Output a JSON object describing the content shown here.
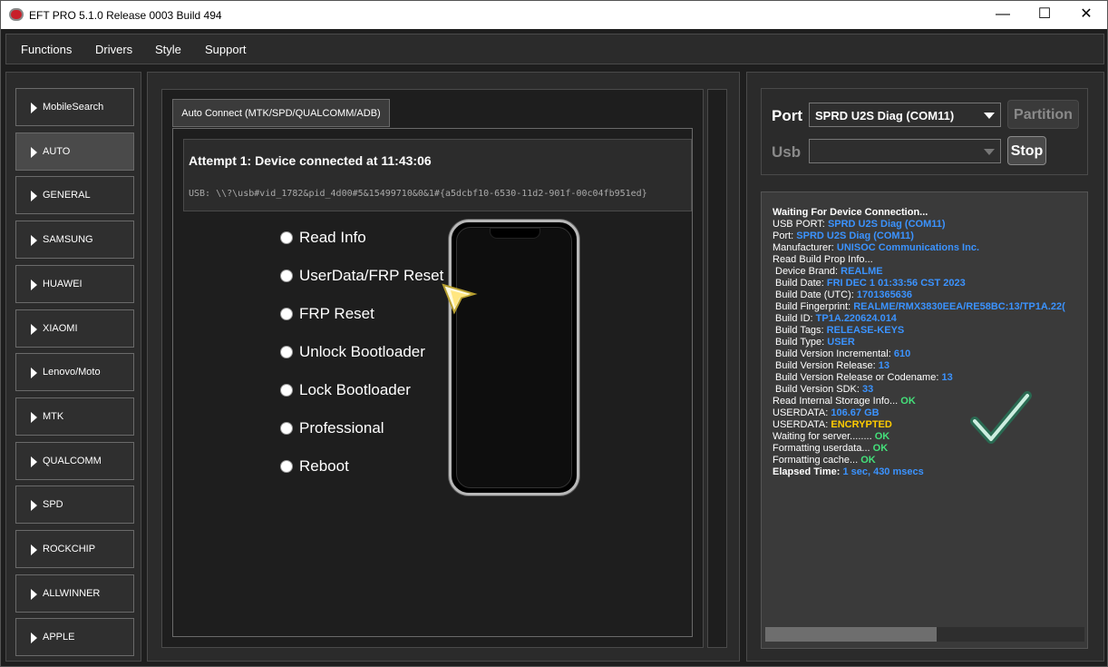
{
  "window": {
    "title": "EFT PRO 5.1.0 Release 0003 Build 494",
    "minimize": "—",
    "maximize": "☐",
    "close": "✕"
  },
  "menu": [
    "Functions",
    "Drivers",
    "Style",
    "Support"
  ],
  "sidebar": [
    {
      "label": "MobileSearch",
      "active": false
    },
    {
      "label": "AUTO",
      "active": true
    },
    {
      "label": "GENERAL",
      "active": false
    },
    {
      "label": "SAMSUNG",
      "active": false
    },
    {
      "label": "HUAWEI",
      "active": false
    },
    {
      "label": "XIAOMI",
      "active": false
    },
    {
      "label": "Lenovo/Moto",
      "active": false
    },
    {
      "label": "MTK",
      "active": false
    },
    {
      "label": "QUALCOMM",
      "active": false
    },
    {
      "label": "SPD",
      "active": false
    },
    {
      "label": "ROCKCHIP",
      "active": false
    },
    {
      "label": "ALLWINNER",
      "active": false
    },
    {
      "label": "APPLE",
      "active": false
    }
  ],
  "main": {
    "tab": "Auto Connect (MTK/SPD/QUALCOMM/ADB)",
    "status": "Attempt 1: Device connected at 11:43:06",
    "usb_path": "USB: \\\\?\\usb#vid_1782&pid_4d00#5&15499710&0&1#{a5dcbf10-6530-11d2-901f-00c04fb951ed}",
    "options": [
      "Read Info",
      "UserData/FRP Reset",
      "FRP Reset",
      "Unlock Bootloader",
      "Lock Bootloader",
      "Professional",
      "Reboot"
    ]
  },
  "port": {
    "port_label": "Port",
    "port_value": "SPRD U2S Diag (COM11)",
    "usb_label": "Usb",
    "usb_value": "",
    "partition_button": "Partition",
    "stop_button": "Stop"
  },
  "log": [
    {
      "indent": false,
      "bold": true,
      "parts": [
        {
          "t": "Waiting For Device Connection...",
          "c": ""
        }
      ]
    },
    {
      "indent": false,
      "parts": [
        {
          "t": "USB PORT: ",
          "c": ""
        },
        {
          "t": "SPRD U2S Diag (COM11)",
          "c": "v"
        }
      ]
    },
    {
      "indent": false,
      "parts": [
        {
          "t": "Port: ",
          "c": ""
        },
        {
          "t": "SPRD U2S Diag (COM11)",
          "c": "v"
        }
      ]
    },
    {
      "indent": false,
      "parts": [
        {
          "t": "Manufacturer: ",
          "c": ""
        },
        {
          "t": "UNISOC Communications Inc.",
          "c": "v"
        }
      ]
    },
    {
      "indent": false,
      "parts": [
        {
          "t": "Read Build Prop Info...",
          "c": ""
        }
      ]
    },
    {
      "indent": true,
      "parts": [
        {
          "t": "Device Brand: ",
          "c": ""
        },
        {
          "t": "REALME",
          "c": "v"
        }
      ]
    },
    {
      "indent": true,
      "parts": [
        {
          "t": "Build Date: ",
          "c": ""
        },
        {
          "t": "FRI DEC  1 01:33:56 CST 2023",
          "c": "v"
        }
      ]
    },
    {
      "indent": true,
      "parts": [
        {
          "t": "Build Date (UTC): ",
          "c": ""
        },
        {
          "t": "1701365636",
          "c": "v"
        }
      ]
    },
    {
      "indent": true,
      "parts": [
        {
          "t": "Build Fingerprint: ",
          "c": ""
        },
        {
          "t": "REALME/RMX3830EEA/RE58BC:13/TP1A.22(",
          "c": "v"
        }
      ]
    },
    {
      "indent": true,
      "parts": [
        {
          "t": "Build ID: ",
          "c": ""
        },
        {
          "t": "TP1A.220624.014",
          "c": "v"
        }
      ]
    },
    {
      "indent": true,
      "parts": [
        {
          "t": "Build Tags: ",
          "c": ""
        },
        {
          "t": "RELEASE-KEYS",
          "c": "v"
        }
      ]
    },
    {
      "indent": true,
      "parts": [
        {
          "t": "Build Type: ",
          "c": ""
        },
        {
          "t": "USER",
          "c": "v"
        }
      ]
    },
    {
      "indent": true,
      "parts": [
        {
          "t": "Build Version Incremental: ",
          "c": ""
        },
        {
          "t": "610",
          "c": "v"
        }
      ]
    },
    {
      "indent": true,
      "parts": [
        {
          "t": "Build Version Release: ",
          "c": ""
        },
        {
          "t": "13",
          "c": "v"
        }
      ]
    },
    {
      "indent": true,
      "parts": [
        {
          "t": "Build Version Release or Codename: ",
          "c": ""
        },
        {
          "t": "13",
          "c": "v"
        }
      ]
    },
    {
      "indent": true,
      "parts": [
        {
          "t": "Build Version SDK: ",
          "c": ""
        },
        {
          "t": "33",
          "c": "v"
        }
      ]
    },
    {
      "indent": false,
      "parts": [
        {
          "t": "Read Internal Storage Info... ",
          "c": ""
        },
        {
          "t": "OK",
          "c": "ok"
        }
      ]
    },
    {
      "indent": false,
      "parts": [
        {
          "t": "USERDATA: ",
          "c": ""
        },
        {
          "t": "106.67 GB",
          "c": "v"
        }
      ]
    },
    {
      "indent": false,
      "parts": [
        {
          "t": "USERDATA: ",
          "c": ""
        },
        {
          "t": "ENCRYPTED",
          "c": "enc"
        }
      ]
    },
    {
      "indent": false,
      "parts": [
        {
          "t": "Waiting for server........ ",
          "c": ""
        },
        {
          "t": "OK",
          "c": "ok"
        }
      ]
    },
    {
      "indent": false,
      "parts": [
        {
          "t": "Formatting userdata... ",
          "c": ""
        },
        {
          "t": "OK",
          "c": "ok"
        }
      ]
    },
    {
      "indent": false,
      "parts": [
        {
          "t": "Formatting cache... ",
          "c": ""
        },
        {
          "t": "OK",
          "c": "ok"
        }
      ]
    },
    {
      "indent": false,
      "bold": true,
      "parts": [
        {
          "t": "Elapsed Time: ",
          "c": ""
        },
        {
          "t": "1 sec, 430 msecs",
          "c": "v"
        }
      ]
    }
  ],
  "colors": {
    "accent_value": "#3b93ff",
    "ok": "#44e07a",
    "warning": "#ffcc00"
  },
  "icons": {
    "app": "eft-logo-icon",
    "success": "checkmark-icon",
    "cursor": "mouse-pointer-icon"
  }
}
